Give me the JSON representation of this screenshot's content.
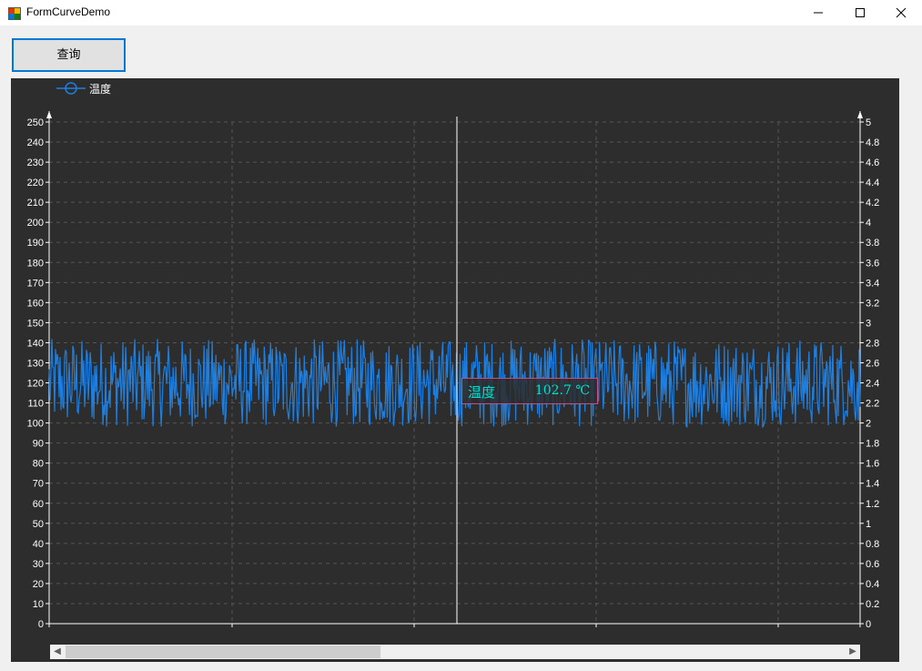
{
  "window": {
    "title": "FormCurveDemo",
    "controls": [
      "minimize",
      "maximize",
      "close"
    ]
  },
  "toolbar": {
    "query_label": "查询"
  },
  "tooltip": {
    "series": "温度",
    "value": "102.7 ℃"
  },
  "colors": {
    "background": "#2d2d2d",
    "line": "#1e7fe0",
    "grid": "#555555",
    "tooltip_text": "#00e0d0",
    "tooltip_border": "#c44d8a",
    "cursor": "#ffffff"
  },
  "chart_data": {
    "type": "line",
    "title": "",
    "legend": {
      "placement": "top-left",
      "entries": [
        "温度"
      ]
    },
    "series": [
      {
        "name": "温度",
        "y_min": 98,
        "y_max": 142,
        "mean": 120
      }
    ],
    "ylabel": "",
    "ylim": [
      0,
      250
    ],
    "y_ticks": [
      "0",
      "10",
      "20",
      "30",
      "40",
      "50",
      "60",
      "70",
      "80",
      "90",
      "100",
      "110",
      "120",
      "130",
      "140",
      "150",
      "160",
      "170",
      "180",
      "190",
      "200",
      "210",
      "220",
      "230",
      "240",
      "250"
    ],
    "y2lim": [
      0,
      5
    ],
    "y2_ticks": [
      "0",
      "0.2",
      "0.4",
      "0.6",
      "0.8",
      "1",
      "1.2",
      "1.4",
      "1.6",
      "1.8",
      "2",
      "2.2",
      "2.4",
      "2.6",
      "2.8",
      "3",
      "3.2",
      "3.4",
      "3.6",
      "3.8",
      "4",
      "4.2",
      "4.4",
      "4.6",
      "4.8",
      "5"
    ],
    "grid": true,
    "cursor_value": 102.7
  }
}
